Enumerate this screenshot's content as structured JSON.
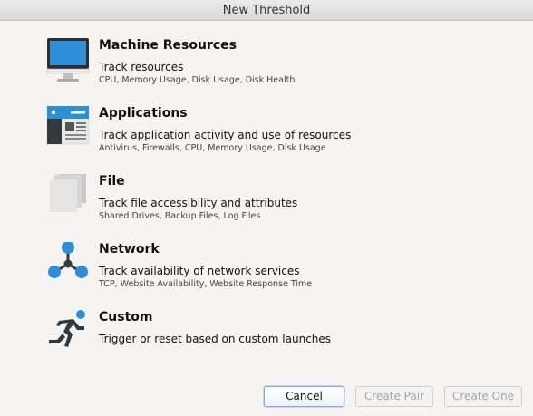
{
  "window": {
    "title": "New Threshold"
  },
  "options": [
    {
      "title": "Machine Resources",
      "subtitle": "Track resources",
      "detail": "CPU, Memory Usage, Disk Usage, Disk Health",
      "icon": "monitor-icon"
    },
    {
      "title": "Applications",
      "subtitle": "Track application activity and use of resources",
      "detail": "Antivirus, Firewalls, CPU, Memory Usage, Disk Usage",
      "icon": "application-window-icon"
    },
    {
      "title": "File",
      "subtitle": "Track file accessibility and attributes",
      "detail": "Shared Drives, Backup Files, Log Files",
      "icon": "stacked-files-icon"
    },
    {
      "title": "Network",
      "subtitle": "Track availability of network services",
      "detail": "TCP, Website Availability, Website Response Time",
      "icon": "network-nodes-icon"
    },
    {
      "title": "Custom",
      "subtitle": "Trigger or reset based on custom launches",
      "detail": "",
      "icon": "running-person-icon"
    }
  ],
  "buttons": {
    "cancel": "Cancel",
    "create_pair": "Create Pair",
    "create_one": "Create One"
  },
  "colors": {
    "accent_blue": "#2f8fd6",
    "icon_dark": "#333a3f",
    "default_button_border": "#8ea7cb"
  }
}
